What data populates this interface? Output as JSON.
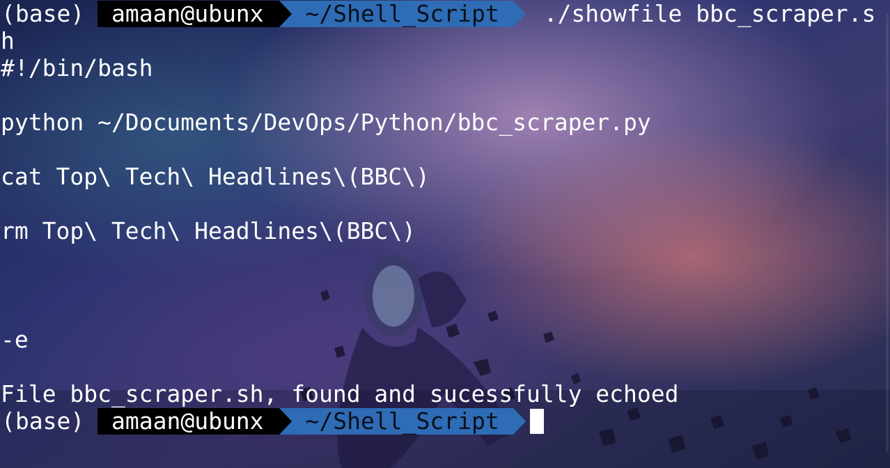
{
  "terminal": {
    "prompt_env": "(base)",
    "prompt_user": "amaan@ubunx",
    "prompt_path": "~/Shell_Script",
    "command": "./showfile bbc_scraper.s",
    "command_wrap": "h",
    "output": [
      "#!/bin/bash",
      "",
      "python ~/Documents/DevOps/Python/bbc_scraper.py",
      "",
      "cat Top\\ Tech\\ Headlines\\(BBC\\)",
      "",
      "rm Top\\ Tech\\ Headlines\\(BBC\\)",
      "",
      "",
      "",
      "-e",
      "",
      "File bbc_scraper.sh, found and sucessfully echoed"
    ]
  },
  "colors": {
    "user_segment_bg": "#000000",
    "path_segment_bg": "#2e6cb5",
    "text": "#ffffff"
  }
}
